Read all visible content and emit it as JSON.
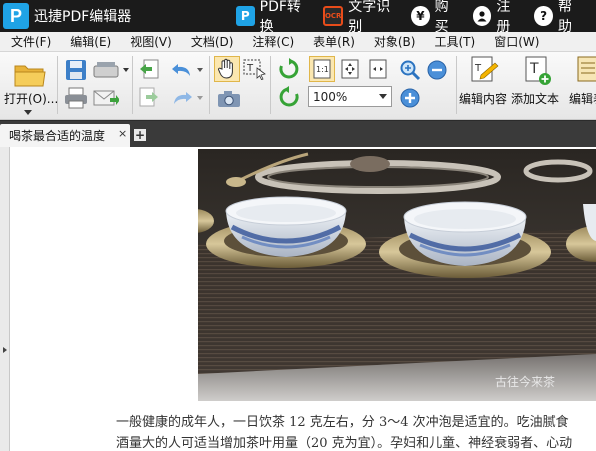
{
  "titlebar": {
    "app_title": "迅捷PDF编辑器",
    "logo_letter": "P",
    "items": [
      {
        "label": "PDF转换",
        "icon": "pdf-convert-icon"
      },
      {
        "label": "文字识别",
        "icon": "ocr-icon"
      },
      {
        "label": "购买",
        "icon": "yen-icon"
      },
      {
        "label": "注册",
        "icon": "user-icon"
      },
      {
        "label": "帮助",
        "icon": "help-icon"
      }
    ]
  },
  "menubar": {
    "items": [
      "文件(F)",
      "编辑(E)",
      "视图(V)",
      "文档(D)",
      "注释(C)",
      "表单(R)",
      "对象(B)",
      "工具(T)",
      "窗口(W)"
    ]
  },
  "toolbar": {
    "open_label": "打开(O)...",
    "edit_content_label": "编辑内容",
    "add_text_label": "添加文本",
    "edit_form_label": "编辑表",
    "zoom_value": "100%"
  },
  "tabs": {
    "active_tab": "喝茶最合适的温度",
    "close_symbol": "×",
    "add_symbol": "+"
  },
  "document": {
    "watermark": "古往今来茶",
    "line1": "一般健康的成年人，一日饮茶 12 克左右，分 3～4 次冲泡是适宜的。吃油腻食",
    "line2": "酒量大的人可适当增加茶叶用量（20 克为宜）。孕妇和儿童、神经衰弱者、心动"
  },
  "colors": {
    "title_bg": "#1b1b1b",
    "accent_blue": "#1fa3e6",
    "ocr_orange": "#e84c1a",
    "tab_bar_bg": "#3a3a3a"
  }
}
